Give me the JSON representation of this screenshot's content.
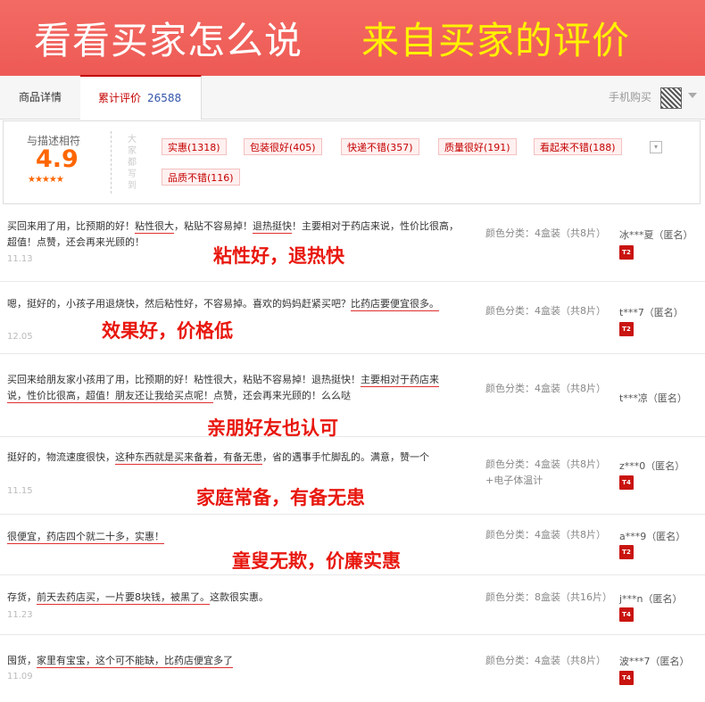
{
  "banner": {
    "title_white": "看看买家怎么说",
    "title_yellow": "来自买家的评价"
  },
  "tabs": {
    "detail": "商品详情",
    "reviews": "累计评价",
    "review_count": "26588",
    "mobile": "手机购买"
  },
  "rating": {
    "label": "与描述相符",
    "score": "4.9",
    "stars": "★★★★★",
    "vertical_label": "大家都写到"
  },
  "tags": [
    "实惠(1318)",
    "包装很好(405)",
    "快递不错(357)",
    "质量很好(191)",
    "看起来不错(188)",
    "品质不错(116)"
  ],
  "reviews": [
    {
      "pre": "买回来用了用，比预期的好！",
      "u1": "粘性很大",
      "mid": "，粘贴不容易掉！",
      "u2": "退热挺快",
      "post": "！主要相对于药店来说，性价比很高，超值！点赞，还会再来光顾的！",
      "date": "11.13",
      "caption": "粘性好，退热快",
      "spec": "颜色分类：4盒装（共8片）",
      "user": "冰***夏（匿名）",
      "badge": "T2"
    },
    {
      "pre": "嗯，挺好的，小孩子用退烧快，然后粘性好，不容易掉。喜欢的妈妈赶紧买吧？",
      "u1": "比药店要便宜很多。",
      "mid": "",
      "u2": "",
      "post": "",
      "date": "12.05",
      "caption": "效果好，价格低",
      "spec": "颜色分类：4盒装（共8片）",
      "user": "t***7（匿名）",
      "badge": "T2"
    },
    {
      "pre": "买回来给朋友家小孩用了用，比预期的好！粘性很大，粘贴不容易掉！退热挺快！",
      "u1": "主要相对于药店来说，性价比很高，超值！朋友还让我给买点呢！",
      "mid": "",
      "u2": "",
      "post": "点赞，还会再来光顾的！么么哒",
      "date": "",
      "caption": "亲朋好友也认可",
      "spec": "颜色分类：4盒装（共8片）",
      "user": "t***凉（匿名）",
      "badge": ""
    },
    {
      "pre": "挺好的，物流速度很快，",
      "u1": "这种东西就是买来备着，有备无患",
      "mid": "，省的遇事手忙脚乱的。满意，赞一个",
      "u2": "",
      "post": "",
      "date": "11.15",
      "caption": "家庭常备，有备无患",
      "spec": "颜色分类：4盒装（共8片）+电子体温计",
      "user": "z***0（匿名）",
      "badge": "T4"
    },
    {
      "pre": "",
      "u1": "很便宜，药店四个就二十多，实惠！",
      "mid": "",
      "u2": "",
      "post": "",
      "date": "",
      "caption": "童叟无欺，价廉实惠",
      "spec": "颜色分类：4盒装（共8片）",
      "user": "a***9（匿名）",
      "badge": "T2"
    },
    {
      "pre": "存货，",
      "u1": "前天去药店买，一片要8块钱，被黑了。",
      "mid": "这款很实惠。",
      "u2": "",
      "post": "",
      "date": "11.23",
      "caption": "",
      "spec": "颜色分类：8盒装（共16片）",
      "user": "j***n（匿名）",
      "badge": "T4"
    },
    {
      "pre": "囤货，",
      "u1": "家里有宝宝，这个可不能缺，比药店便宜多了",
      "mid": "",
      "u2": "",
      "post": "",
      "date": "11.09",
      "caption": "",
      "spec": "颜色分类：4盒装（共8片）",
      "user": "波***7（匿名）",
      "badge": "T4"
    }
  ]
}
